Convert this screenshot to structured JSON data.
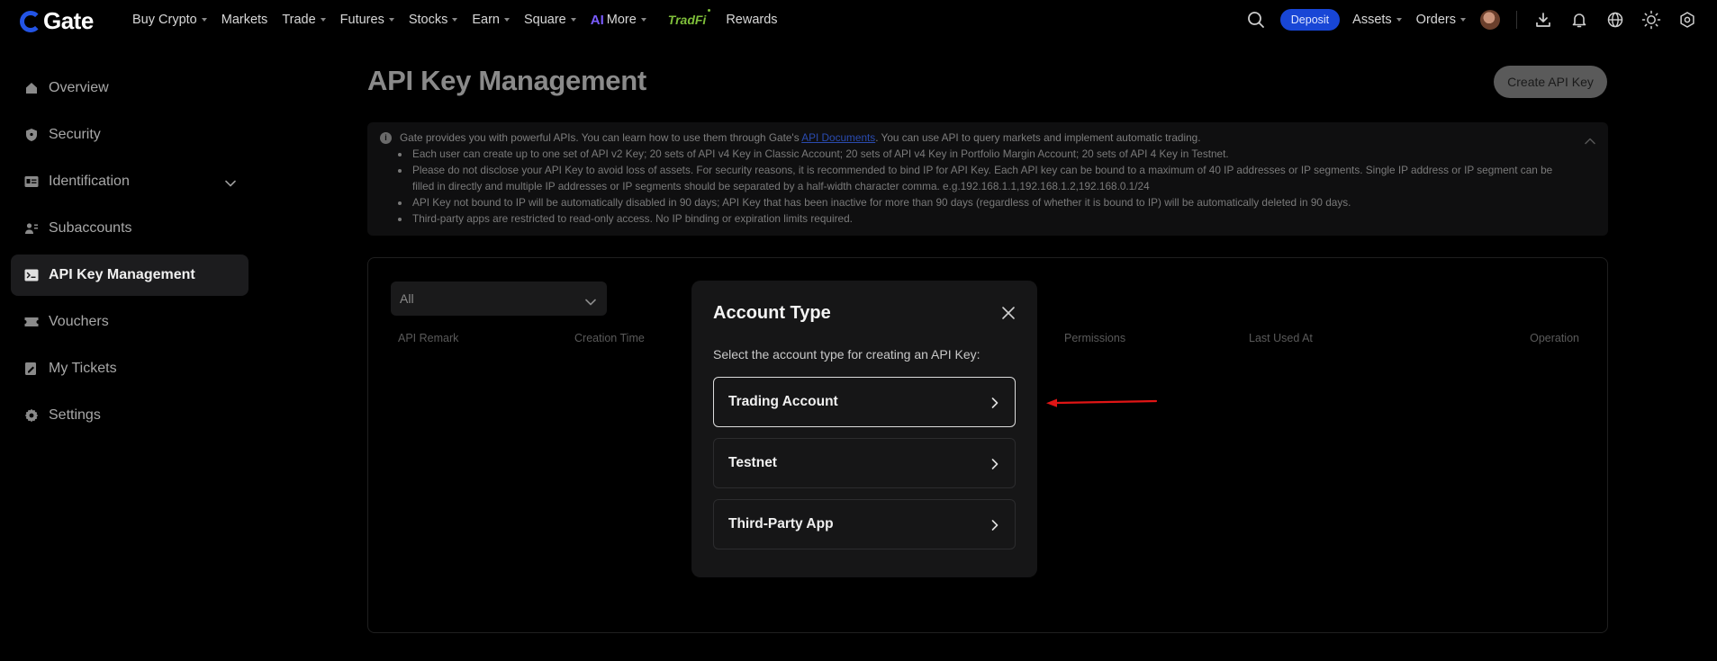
{
  "brand": {
    "logo_text": "Gate",
    "accent": "#2354e6"
  },
  "nav": {
    "items": [
      {
        "label": "Buy Crypto",
        "caret": true
      },
      {
        "label": "Markets",
        "caret": false
      },
      {
        "label": "Trade",
        "caret": true
      },
      {
        "label": "Futures",
        "caret": true
      },
      {
        "label": "Stocks",
        "caret": true
      },
      {
        "label": "Earn",
        "caret": true
      },
      {
        "label": "Square",
        "caret": true
      }
    ],
    "more_label": "More",
    "more_prefix": "AI",
    "tradfi_label": "TradFi",
    "rewards_label": "Rewards",
    "deposit_label": "Deposit",
    "assets_label": "Assets",
    "orders_label": "Orders"
  },
  "sidebar": {
    "items": [
      {
        "label": "Overview",
        "icon": "home-icon"
      },
      {
        "label": "Security",
        "icon": "shield-icon"
      },
      {
        "label": "Identification",
        "icon": "id-card-icon"
      },
      {
        "label": "Subaccounts",
        "icon": "users-icon"
      },
      {
        "label": "API Key Management",
        "icon": "api-terminal-icon"
      },
      {
        "label": "Vouchers",
        "icon": "ticket-icon"
      },
      {
        "label": "My Tickets",
        "icon": "tickets-edit-icon"
      },
      {
        "label": "Settings",
        "icon": "gear-icon"
      }
    ],
    "active_index": 4
  },
  "page": {
    "title": "API Key Management",
    "create_button": "Create API Key"
  },
  "info": {
    "intro_before": "Gate provides you with powerful APIs. You can learn how to use them through Gate's ",
    "intro_link": "API Documents",
    "intro_after": ". You can use API to query markets and implement automatic trading.",
    "bullets": [
      "Each user can create up to one set of API v2 Key; 20 sets of API v4 Key in Classic Account; 20 sets of API v4 Key in Portfolio Margin Account; 20 sets of API 4 Key in Testnet.",
      "Please do not disclose your API Key to avoid loss of assets. For security reasons, it is recommended to bind IP for API Key. Each API key can be bound to a maximum of 40 IP addresses or IP segments. Single IP address or IP segment can be filled in directly and multiple IP addresses or IP segments should be separated by a half-width character comma. e.g.192.168.1.1,192.168.1.2,192.168.0.1/24",
      "API Key not bound to IP will be automatically disabled in 90 days; API Key that has been inactive for more than 90 days (regardless of whether it is bound to IP) will be automatically deleted in 90 days.",
      "Third-party apps are restricted to read-only access. No IP binding or expiration limits required."
    ]
  },
  "table": {
    "filter_value": "All",
    "columns": [
      "API Remark",
      "Creation Time",
      "Permissions",
      "Last Used At",
      "Operation"
    ]
  },
  "modal": {
    "title": "Account Type",
    "subtitle": "Select the account type for creating an API Key:",
    "options": [
      "Trading Account",
      "Testnet",
      "Third-Party App"
    ],
    "selected_index": 0
  }
}
